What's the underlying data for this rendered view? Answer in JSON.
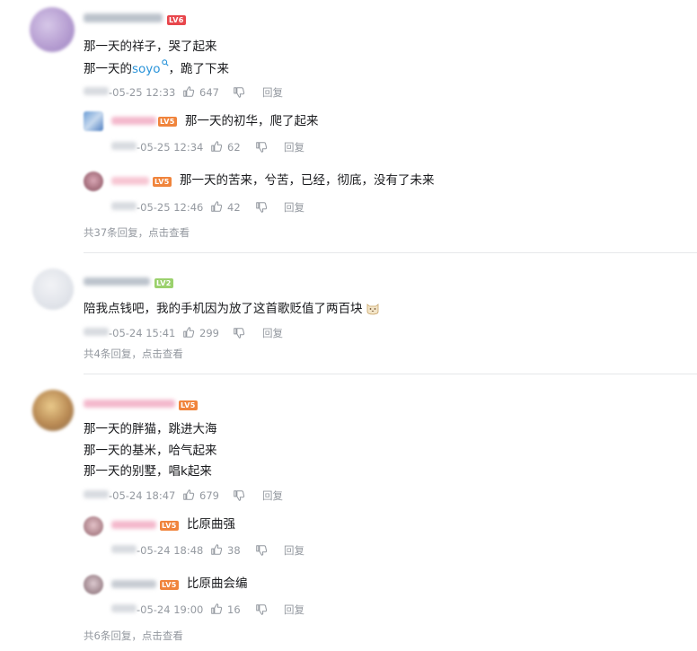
{
  "comments": [
    {
      "lines": [
        "那一天的祥子，哭了起来"
      ],
      "line2_prefix": "那一天的",
      "line2_link": "soyo",
      "line2_suffix": "，跪了下来",
      "level": "LV6",
      "time": "-05-25 12:33",
      "likes": "647",
      "reply_label": "回复",
      "replies": [
        {
          "text": "那一天的初华，爬了起来",
          "level": "LV5",
          "time": "-05-25 12:34",
          "likes": "62",
          "reply_label": "回复"
        },
        {
          "text": "那一天的苦来，兮苦，已经，彻底，没有了未来",
          "level": "LV5",
          "time": "-05-25 12:46",
          "likes": "42",
          "reply_label": "回复"
        }
      ],
      "more": "共37条回复，点击查看"
    },
    {
      "text": "陪我点钱吧，我的手机因为放了这首歌贬值了两百块",
      "level": "LV2",
      "time": "-05-24 15:41",
      "likes": "299",
      "reply_label": "回复",
      "more": "共4条回复，点击查看"
    },
    {
      "lines": [
        "那一天的胖猫，跳进大海",
        "那一天的基米，哈气起来",
        "那一天的别墅，唱k起来"
      ],
      "level": "LV5",
      "time": "-05-24 18:47",
      "likes": "679",
      "reply_label": "回复",
      "replies": [
        {
          "text": "比原曲强",
          "level": "LV5",
          "time": "-05-24 18:48",
          "likes": "38",
          "reply_label": "回复"
        },
        {
          "text": "比原曲会编",
          "level": "LV5",
          "time": "-05-24 19:00",
          "likes": "16",
          "reply_label": "回复"
        }
      ],
      "more": "共6条回复，点击查看"
    }
  ],
  "icons": {
    "like": "thumbs-up-icon",
    "dislike": "thumbs-down-icon",
    "search": "search-icon",
    "emoji": "cat-face-emoji"
  },
  "colors": {
    "text": "#18191c",
    "meta": "#9499a0",
    "link": "#2993d9",
    "lv6": "#e8464c",
    "lv5": "#f0843c",
    "lv2": "#9bd16d"
  }
}
